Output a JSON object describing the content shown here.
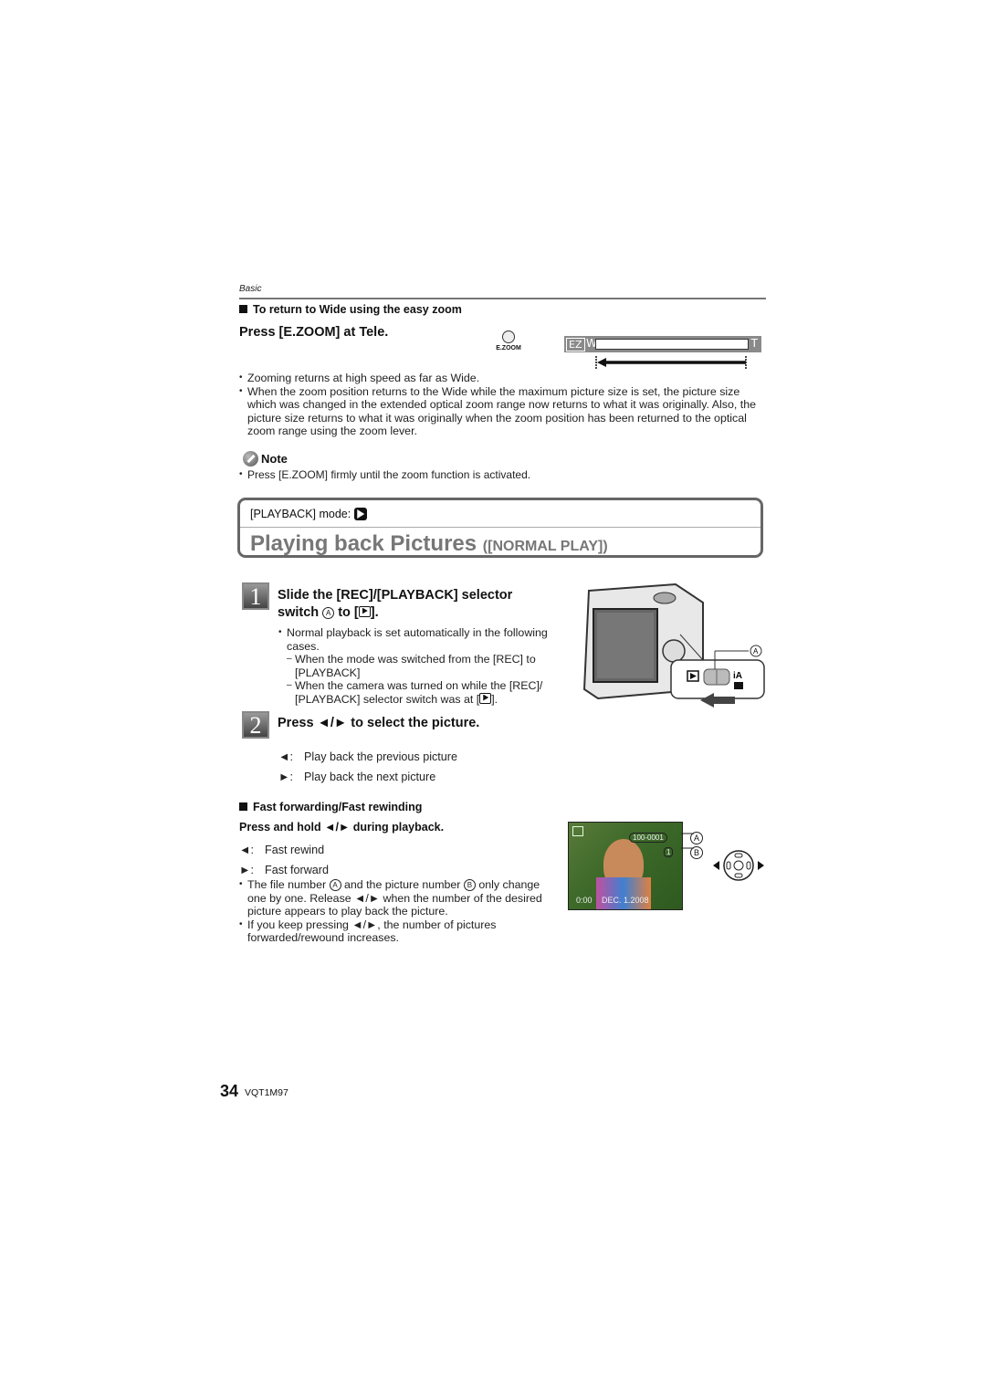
{
  "header": {
    "section": "Basic"
  },
  "easy_zoom": {
    "heading": "To return to Wide using the easy zoom",
    "instruction": "Press [E.ZOOM] at Tele.",
    "button_label": "E.ZOOM",
    "zoom_bar": {
      "ez": "EZ",
      "wide": "W",
      "tele": "T"
    },
    "bullets": [
      "Zooming returns at high speed as far as Wide.",
      "When the zoom position returns to the Wide while the maximum picture size is set, the picture size which was changed in the extended optical zoom range now returns to what it was originally. Also, the picture size returns to what it was originally when the zoom position has been returned to the optical zoom range using the zoom lever."
    ]
  },
  "note": {
    "title": "Note",
    "bullets": [
      "Press [E.ZOOM] firmly until the zoom function is activated."
    ]
  },
  "playback_box": {
    "mode_label": "[PLAYBACK] mode:",
    "title": "Playing back Pictures",
    "subtitle": "([NORMAL PLAY])"
  },
  "step1": {
    "number": "1",
    "title_part1": "Slide the [REC]/[PLAYBACK] selector",
    "title_part2": "switch",
    "marker": "A",
    "title_part3": "to [",
    "title_part4": "].",
    "bullet": "Normal playback is set automatically in the following cases.",
    "dashes": [
      "When the mode was switched from the [REC] to [PLAYBACK]",
      "When the camera was turned on while the [REC]/ [PLAYBACK] selector switch was at ["
    ],
    "dash2_end": "].",
    "illustration_marker": "A"
  },
  "step2": {
    "number": "2",
    "title": "Press ◄/► to select the picture.",
    "items": [
      {
        "key": "◄:",
        "text": "Play back the previous picture"
      },
      {
        "key": "►:",
        "text": "Play back the next picture"
      }
    ]
  },
  "fast": {
    "heading": "Fast forwarding/Fast rewinding",
    "instruction": "Press and hold ◄/► during playback.",
    "items": [
      {
        "key": "◄:",
        "text": "Fast rewind"
      },
      {
        "key": "►:",
        "text": "Fast forward"
      }
    ],
    "bullet1_a": "The file number",
    "marker_a": "A",
    "bullet1_b": "and the picture number",
    "marker_b": "B",
    "bullet1_c": "only change one by one. Release ◄/► when the number of the desired picture appears to play back the picture.",
    "bullet2": "If you keep pressing ◄/►, the number of pictures forwarded/rewound increases.",
    "screen": {
      "file_number": "100-0001",
      "picture_number": "1",
      "time": "0:00",
      "date": "DEC. 1.2008"
    },
    "callouts": [
      "A",
      "B"
    ]
  },
  "footer": {
    "page": "34",
    "code": "VQT1M97"
  }
}
